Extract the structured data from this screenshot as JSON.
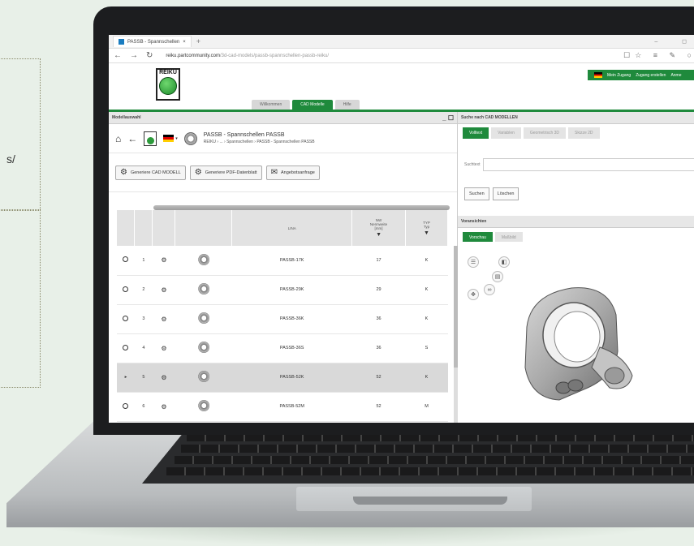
{
  "background": {
    "left_text": "s/"
  },
  "browser": {
    "tab_title": "PASSB - Spannschellen",
    "url_host": "reiku.partcommunity.com",
    "url_path": "/3d-cad-models/passb-spannschellen-passb-reiku/",
    "new_tab": "+",
    "window_controls": "– ◻",
    "icons": [
      "back-icon",
      "forward-icon",
      "refresh-icon",
      "star-icon",
      "menu-icon",
      "edit-icon",
      "profile-icon"
    ]
  },
  "site": {
    "logo_text": "REIKU",
    "top_links": [
      "Mein Zugang",
      "Zugang erstellen",
      "Anme"
    ],
    "tabs": [
      "Willkommen",
      "CAD Modelle",
      "Hilfe"
    ],
    "active_tab": "CAD Modelle"
  },
  "left_panel": {
    "title": "Modellauswahl",
    "product_title": "PASSB - Spannschellen PASSB",
    "breadcrumb": "REIKU  ›  ...  ›  Spannschellen  ›  PASSB - Spannschellen PASSB",
    "actions": [
      {
        "label": "Generiere CAD MODELL",
        "icon": "gear-icon"
      },
      {
        "label": "Generiere PDF-Datenblatt",
        "icon": "pdf-gear-icon"
      },
      {
        "label": "Angebotsanfrage",
        "icon": "quote-request-icon"
      }
    ],
    "table": {
      "columns": [
        "",
        "",
        "",
        "",
        "LINA",
        "NW\nNennweite\n[mm]",
        "TYP\nTyp"
      ],
      "rows": [
        {
          "no": "1",
          "lina": "PASSB-17K",
          "nw": "17",
          "typ": "K",
          "selected": false
        },
        {
          "no": "2",
          "lina": "PASSB-29K",
          "nw": "29",
          "typ": "K",
          "selected": false
        },
        {
          "no": "3",
          "lina": "PASSB-36K",
          "nw": "36",
          "typ": "K",
          "selected": false
        },
        {
          "no": "4",
          "lina": "PASSB-36S",
          "nw": "36",
          "typ": "S",
          "selected": false
        },
        {
          "no": "5",
          "lina": "PASSB-52K",
          "nw": "52",
          "typ": "K",
          "selected": true
        },
        {
          "no": "6",
          "lina": "PASSB-52M",
          "nw": "52",
          "typ": "M",
          "selected": false
        }
      ]
    }
  },
  "right_panel": {
    "search_title": "Suche nach CAD MODELLEN",
    "search_tabs": [
      "Volltext",
      "Variablen",
      "Geometrisch 3D",
      "Skizze 2D"
    ],
    "search_label": "Suchtext",
    "search_value": "",
    "buttons": [
      "Suchen",
      "Löschen"
    ],
    "viewer_title": "Voransichten",
    "viewer_tabs": [
      "Vorschau",
      "Maßbild"
    ]
  }
}
